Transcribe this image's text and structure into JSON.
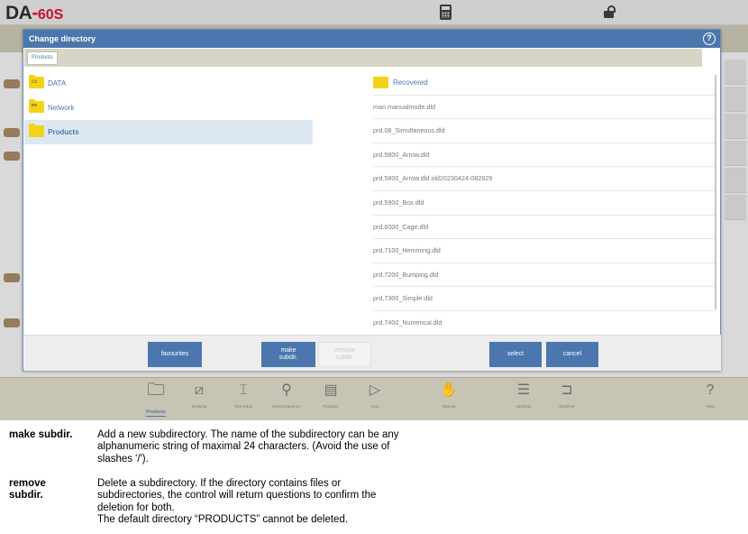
{
  "app": {
    "logo_text": "DA",
    "logo_separator": "-",
    "logo_model": "60S"
  },
  "dialog": {
    "title": "Change directory",
    "help_glyph": "?",
    "path_chip": "Products",
    "directories": [
      {
        "label": "DATA",
        "icon": "drive-folder-icon",
        "glyph": "▭",
        "selected": false
      },
      {
        "label": "Network",
        "icon": "network-folder-icon",
        "glyph": "⚯",
        "selected": false
      },
      {
        "label": "Products",
        "icon": "folder-icon",
        "glyph": "",
        "selected": true
      }
    ],
    "files": [
      {
        "label": "Recovered",
        "is_folder": true
      },
      {
        "label": "man.manualmode.dld",
        "is_folder": false
      },
      {
        "label": "prd.08_Simultaneous.dld",
        "is_folder": false
      },
      {
        "label": "prd.5800_Arrow.dld",
        "is_folder": false
      },
      {
        "label": "prd.5800_Arrow.dld.old20230424-082629",
        "is_folder": false
      },
      {
        "label": "prd.5900_Box.dld",
        "is_folder": false
      },
      {
        "label": "prd.6000_Cage.dld",
        "is_folder": false
      },
      {
        "label": "prd.7100_Hemming.dld",
        "is_folder": false
      },
      {
        "label": "prd.7200_Bumping.dld",
        "is_folder": false
      },
      {
        "label": "prd.7300_Simple.dld",
        "is_folder": false
      },
      {
        "label": "prd.7400_Numerical.dld",
        "is_folder": false
      }
    ],
    "buttons": {
      "favourites": "favourites",
      "make_subdir_line1": "make",
      "make_subdir_line2": "subdir.",
      "remove_subdir_line1": "remove",
      "remove_subdir_line2": "subdir.",
      "select": "select",
      "cancel": "cancel"
    }
  },
  "toolbar": {
    "items": [
      {
        "name": "products",
        "label": "Products",
        "icon": "folder-icon",
        "glyph": "🗀",
        "active": true
      },
      {
        "name": "drawing",
        "label": "Drawing",
        "icon": "drawing-icon",
        "glyph": "⧄",
        "active": false
      },
      {
        "name": "tool-setup",
        "label": "Tool setup",
        "icon": "tool-setup-icon",
        "glyph": "⌶",
        "active": false
      },
      {
        "name": "bend-sequence",
        "label": "Bend sequence",
        "icon": "bend-sequence-icon",
        "glyph": "⚲",
        "active": false
      },
      {
        "name": "program",
        "label": "Program",
        "icon": "program-icon",
        "glyph": "▤",
        "active": false
      },
      {
        "name": "auto",
        "label": "Auto",
        "icon": "play-icon",
        "glyph": "▷",
        "active": false
      },
      {
        "name": "manual",
        "label": "Manual",
        "icon": "hand-icon",
        "glyph": "✋",
        "active": false
      },
      {
        "name": "settings",
        "label": "Settings",
        "icon": "settings-list-icon",
        "glyph": "☰",
        "active": false
      },
      {
        "name": "machine",
        "label": "Machine",
        "icon": "machine-icon",
        "glyph": "⊐",
        "active": false
      },
      {
        "name": "help",
        "label": "Help",
        "icon": "help-icon",
        "glyph": "?",
        "active": false
      }
    ]
  },
  "documentation": {
    "entries": [
      {
        "term": "make subdir.",
        "lines": [
          "Add a new subdirectory. The name of the subdirectory can be any",
          "alphanumeric string of maximal 24 characters. (Avoid the use of",
          "slashes '/')."
        ]
      },
      {
        "term_line1": "remove",
        "term_line2": "subdir.",
        "lines": [
          "Delete a subdirectory. If the directory contains files or",
          "subdirectories, the control will return questions to confirm the",
          "deletion for both.",
          "The default directory “PRODUCTS” cannot be deleted."
        ]
      }
    ]
  },
  "colors": {
    "accent": "#4b77ae",
    "folder": "#f3d21a",
    "brand_red": "#c8102e",
    "toolbar_bg": "#c8c4b3"
  }
}
